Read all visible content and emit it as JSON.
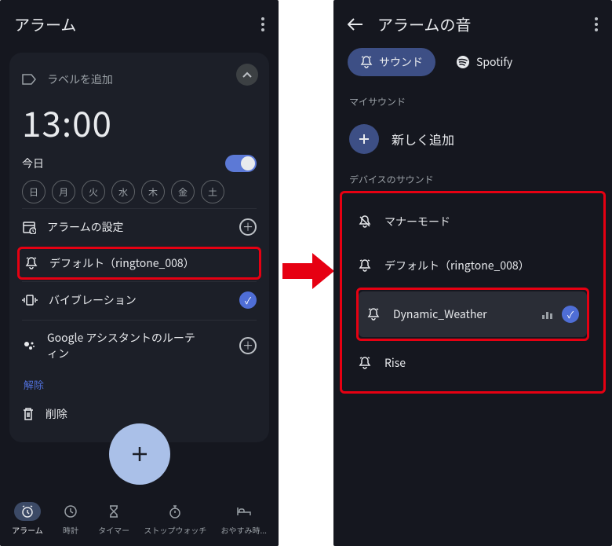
{
  "left": {
    "header_title": "アラーム",
    "label_placeholder": "ラベルを追加",
    "time": "13:00",
    "today": "今日",
    "days": [
      "日",
      "月",
      "火",
      "水",
      "木",
      "金",
      "土"
    ],
    "settings": {
      "alarm_settings": "アラームの設定",
      "ringtone": "デフォルト（ringtone_008）",
      "vibration": "バイブレーション",
      "assistant": "Google アシスタントのルーティン"
    },
    "dismiss": "解除",
    "delete": "削除",
    "nav": {
      "alarm": "アラーム",
      "clock": "時計",
      "timer": "タイマー",
      "stopwatch": "ストップウォッチ",
      "bedtime": "おやすみ時..."
    }
  },
  "right": {
    "header_title": "アラームの音",
    "chip_sound": "サウンド",
    "chip_spotify": "Spotify",
    "section_my": "マイサウンド",
    "add_new": "新しく追加",
    "section_device": "デバイスのサウンド",
    "items": {
      "silent": "マナーモード",
      "default": "デフォルト（ringtone_008）",
      "dynamic": "Dynamic_Weather",
      "rise": "Rise"
    }
  }
}
